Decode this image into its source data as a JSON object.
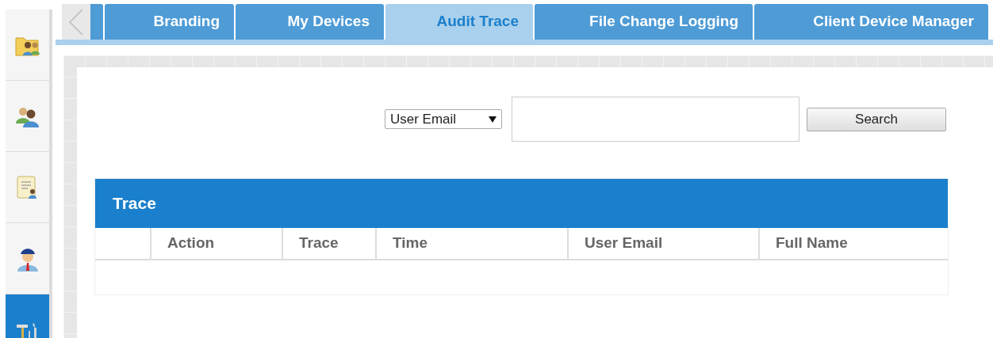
{
  "sidebar": {
    "items": [
      {
        "kind": "folder-people",
        "selected": false
      },
      {
        "kind": "people",
        "selected": false
      },
      {
        "kind": "scroll",
        "selected": false
      },
      {
        "kind": "person",
        "selected": false
      },
      {
        "kind": "tools",
        "selected": true
      }
    ]
  },
  "tabs": [
    {
      "label": "Branding",
      "selected": false
    },
    {
      "label": "My Devices",
      "selected": false
    },
    {
      "label": "Audit Trace",
      "selected": true
    },
    {
      "label": "File Change Logging",
      "selected": false
    },
    {
      "label": "Client Device Manager",
      "selected": false
    }
  ],
  "search": {
    "filter": "User Email",
    "button": "Search"
  },
  "table": {
    "title": "Trace",
    "columns": [
      "Action",
      "Trace",
      "Time",
      "User Email",
      "Full Name"
    ]
  }
}
